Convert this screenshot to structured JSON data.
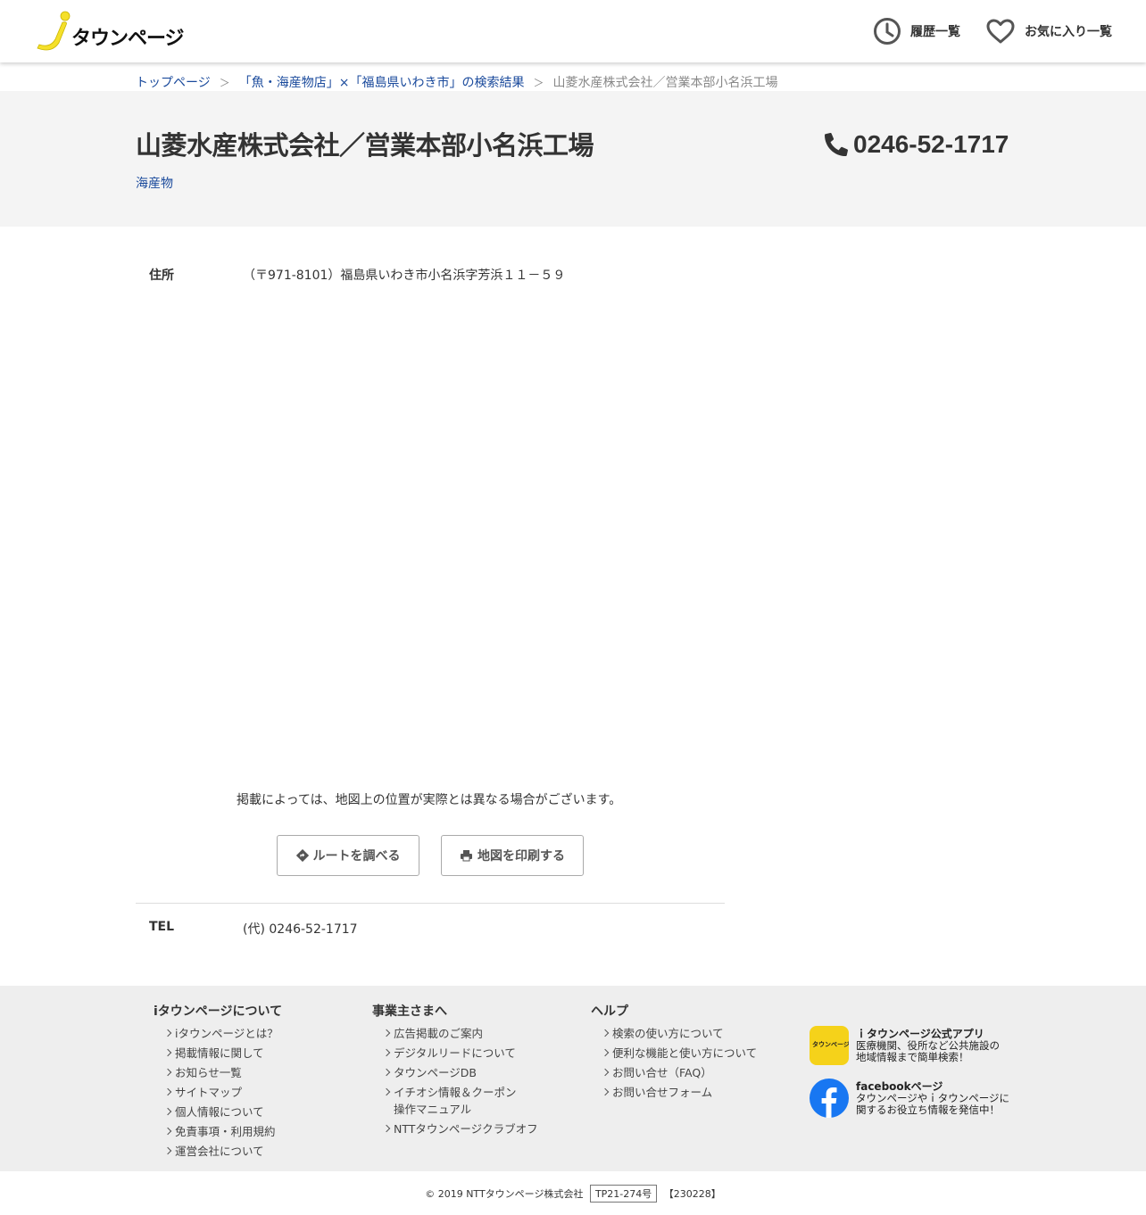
{
  "header": {
    "logo_text": "タウンページ",
    "history_label": "履歴一覧",
    "favorites_label": "お気に入り一覧"
  },
  "breadcrumb": {
    "top": "トップページ",
    "search_result": "「魚・海産物店」×「福島県いわき市」の検索結果",
    "current": "山菱水産株式会社／営業本部小名浜工場",
    "separator": "＞"
  },
  "listing": {
    "name": "山菱水産株式会社／営業本部小名浜工場",
    "category": "海産物",
    "phone": "0246-52-1717",
    "address_label": "住所",
    "address": "（〒971-8101）福島県いわき市小名浜字芳浜１１－５９",
    "map_note": "掲載によっては、地図上の位置が実際とは異なる場合がございます。",
    "route_button": "ルートを調べる",
    "print_button": "地図を印刷する",
    "tel_label": "TEL",
    "tel_value": "(代) 0246-52-1717"
  },
  "footer": {
    "col1": {
      "heading": "iタウンページについて",
      "items": [
        "iタウンページとは？",
        "掲載情報に関して",
        "お知らせ一覧",
        "サイトマップ",
        "個人情報について",
        "免責事項・利用規約",
        "運営会社について"
      ]
    },
    "col2": {
      "heading": "事業主さまへ",
      "items": [
        "広告掲載のご案内",
        "デジタルリードについて",
        "タウンページDB",
        "イチオシ情報＆クーポン",
        "操作マニュアル",
        "NTTタウンページクラブオフ"
      ]
    },
    "col3": {
      "heading": "ヘルプ",
      "items": [
        "検索の使い方について",
        "便利な機能と使い方について",
        "お問い合せ（FAQ）",
        "お問い合せフォーム"
      ]
    },
    "app_promo": {
      "title": "ｉタウンページ公式アプリ",
      "line1": "医療機関、役所など公共施設の",
      "line2": "地域情報まで簡単検索！",
      "icon_text": "タウンページ"
    },
    "fb_promo": {
      "title": "facebookページ",
      "line1": "タウンページやｉタウンページに",
      "line2": "関するお役立ち情報を発信中！"
    },
    "copyright": "© 2019 NTTタウンページ株式会社",
    "code": "TP21-274号",
    "date_code": "【230228】"
  },
  "colors": {
    "link": "#1a4a9c",
    "logo_yellow": "#f5e02a",
    "title_band": "#f4f4f4",
    "footer_bg": "#eeeeee",
    "facebook_blue": "#1877f2"
  }
}
